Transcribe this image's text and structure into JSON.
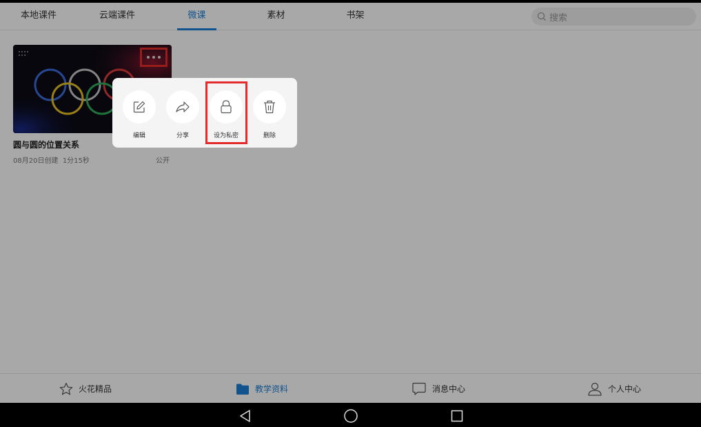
{
  "tabs": [
    {
      "label": "本地课件"
    },
    {
      "label": "云端课件"
    },
    {
      "label": "微课"
    },
    {
      "label": "素材"
    },
    {
      "label": "书架"
    }
  ],
  "active_tab": "微课",
  "search": {
    "placeholder": "搜索"
  },
  "card": {
    "title": "圆与圆的位置关系",
    "created": "08月20日创建",
    "duration": "1分15秒",
    "visibility": "公开"
  },
  "popup": {
    "actions": [
      {
        "label": "编辑",
        "icon": "edit-icon"
      },
      {
        "label": "分享",
        "icon": "share-icon"
      },
      {
        "label": "设为私密",
        "icon": "lock-icon"
      },
      {
        "label": "删除",
        "icon": "trash-icon"
      }
    ]
  },
  "bottom_nav": [
    {
      "label": "火花精品",
      "icon": "star-icon"
    },
    {
      "label": "教学资料",
      "icon": "folder-icon"
    },
    {
      "label": "消息中心",
      "icon": "message-icon"
    },
    {
      "label": "个人中心",
      "icon": "user-icon"
    }
  ],
  "active_nav": "教学资料",
  "colors": {
    "accent": "#1a7fd6",
    "highlight": "#e52c2c"
  }
}
